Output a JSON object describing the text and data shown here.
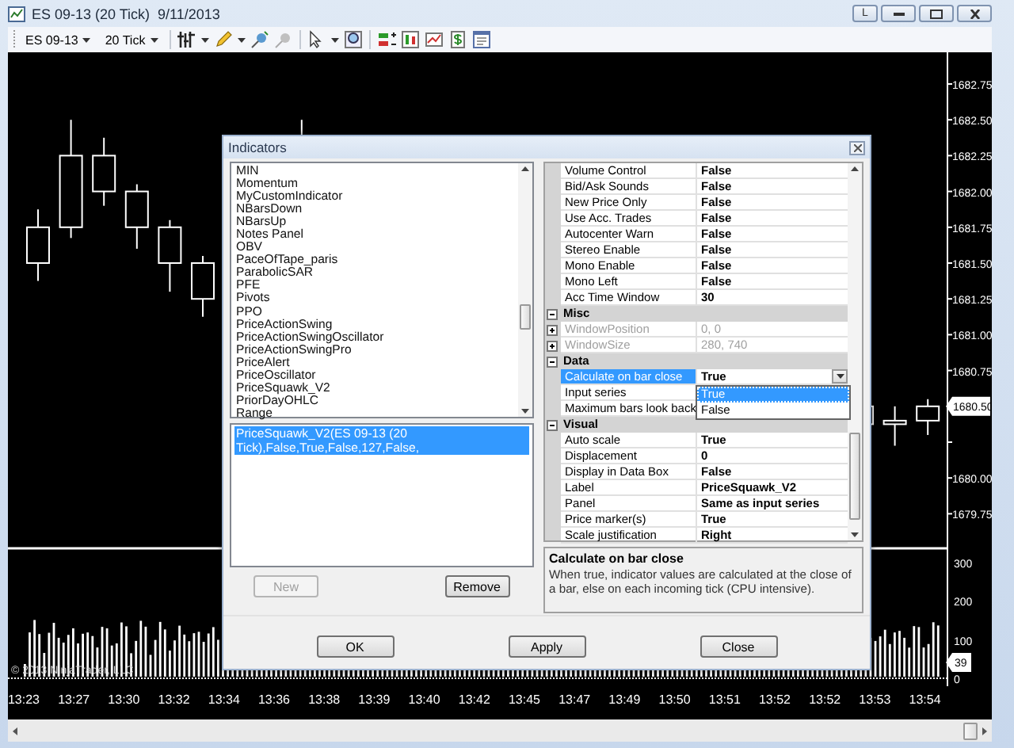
{
  "window": {
    "title": "ES 09-13 (20 Tick)  9/11/2013",
    "link_button": "L"
  },
  "toolbar": {
    "instrument": "ES 09-13",
    "interval": "20 Tick"
  },
  "chart": {
    "price_labels": [
      "1682.75",
      "1682.50",
      "1682.25",
      "1682.00",
      "1681.75",
      "1681.50",
      "1681.25",
      "1681.00",
      "1680.75",
      "1680.00",
      "1679.75"
    ],
    "price_marker": "1680.50",
    "volume_labels": [
      "300",
      "200",
      "100",
      "0"
    ],
    "volume_marker": "39",
    "time_labels": [
      "13:23",
      "13:27",
      "13:30",
      "13:32",
      "13:34",
      "13:36",
      "13:38",
      "13:39",
      "13:40",
      "13:42",
      "13:45",
      "13:47",
      "13:49",
      "13:50",
      "13:51",
      "13:52",
      "13:52",
      "13:53",
      "13:54"
    ],
    "copyright": "© 2013 NinjaTrader, LLC"
  },
  "dialog": {
    "title": "Indicators",
    "available_indicators": [
      "MIN",
      "Momentum",
      "MyCustomIndicator",
      "NBarsDown",
      "NBarsUp",
      "Notes Panel",
      "OBV",
      "PaceOfTape_paris",
      "ParabolicSAR",
      "PFE",
      "Pivots",
      "PPO",
      "PriceActionSwing",
      "PriceActionSwingOscillator",
      "PriceActionSwingPro",
      "PriceAlert",
      "PriceOscillator",
      "PriceSquawk_V2",
      "PriorDayOHLC",
      "Range"
    ],
    "configured_indicators": [
      {
        "label": "PriceSquawk_V2(ES 09-13 (20 Tick),False,True,False,127,False,",
        "selected": true
      }
    ],
    "list_buttons": [
      {
        "label": "New",
        "disabled": true
      },
      {
        "label": "Remove",
        "disabled": false
      }
    ],
    "properties": [
      {
        "kind": "property",
        "name": "Volume Control",
        "value": "False",
        "disabled": false,
        "selected": false
      },
      {
        "kind": "property",
        "name": "Bid/Ask Sounds",
        "value": "False",
        "disabled": false,
        "selected": false
      },
      {
        "kind": "property",
        "name": "New Price Only",
        "value": "False",
        "disabled": false,
        "selected": false
      },
      {
        "kind": "property",
        "name": "Use Acc. Trades",
        "value": "False",
        "disabled": false,
        "selected": false
      },
      {
        "kind": "property",
        "name": "Autocenter Warn",
        "value": "False",
        "disabled": false,
        "selected": false
      },
      {
        "kind": "property",
        "name": "Stereo Enable",
        "value": "False",
        "disabled": false,
        "selected": false
      },
      {
        "kind": "property",
        "name": "Mono Enable",
        "value": "False",
        "disabled": false,
        "selected": false
      },
      {
        "kind": "property",
        "name": "Mono Left",
        "value": "False",
        "disabled": false,
        "selected": false
      },
      {
        "kind": "property",
        "name": "Acc Time Window",
        "value": "30",
        "disabled": false,
        "selected": false
      },
      {
        "kind": "category",
        "name": "Misc",
        "expanded": true
      },
      {
        "kind": "group",
        "name": "WindowPosition",
        "value": "0, 0",
        "disabled": true,
        "selected": false,
        "expanded": false
      },
      {
        "kind": "group",
        "name": "WindowSize",
        "value": "280, 740",
        "disabled": true,
        "selected": false,
        "expanded": false
      },
      {
        "kind": "category",
        "name": "Data",
        "expanded": true
      },
      {
        "kind": "property",
        "name": "Calculate on bar close",
        "value": "True",
        "disabled": false,
        "selected": true,
        "dropdown": {
          "options": [
            {
              "label": "True",
              "selected": true
            },
            {
              "label": "False",
              "selected": false
            }
          ]
        }
      },
      {
        "kind": "property",
        "name": "Input series",
        "disabled": false,
        "selected": false
      },
      {
        "kind": "property",
        "name": "Maximum bars look back",
        "disabled": false,
        "selected": false
      },
      {
        "kind": "category",
        "name": "Visual",
        "expanded": true
      },
      {
        "kind": "property",
        "name": "Auto scale",
        "value": "True",
        "disabled": false,
        "selected": false
      },
      {
        "kind": "property",
        "name": "Displacement",
        "value": "0",
        "disabled": false,
        "selected": false
      },
      {
        "kind": "property",
        "name": "Display in Data Box",
        "value": "False",
        "disabled": false,
        "selected": false
      },
      {
        "kind": "property",
        "name": "Label",
        "value": "PriceSquawk_V2",
        "disabled": false,
        "selected": false
      },
      {
        "kind": "property",
        "name": "Panel",
        "value": "Same as input series",
        "disabled": false,
        "selected": false
      },
      {
        "kind": "property",
        "name": "Price marker(s)",
        "value": "True",
        "disabled": false,
        "selected": false
      },
      {
        "kind": "property",
        "name": "Scale justification",
        "value": "Right",
        "disabled": false,
        "selected": false
      }
    ],
    "description": {
      "title": "Calculate on bar close",
      "text": "When true, indicator values are calculated at the close of a bar, else on each incoming tick (CPU intensive)."
    },
    "footer_buttons": [
      "OK",
      "Apply",
      "Close"
    ]
  }
}
